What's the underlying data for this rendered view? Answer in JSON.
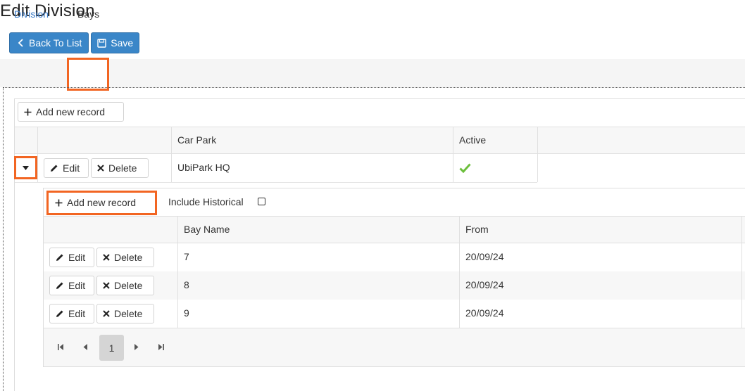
{
  "page": {
    "title": "Edit Division"
  },
  "toolbar": {
    "back_label": "Back To List",
    "save_label": "Save"
  },
  "tabs": [
    {
      "label": "Division"
    },
    {
      "label": "Bays"
    }
  ],
  "outer_grid": {
    "add_label": "Add new record",
    "columns": [
      "Car Park",
      "Active"
    ],
    "rows": [
      {
        "edit_label": "Edit",
        "delete_label": "Delete",
        "car_park": "UbiPark HQ",
        "active": true
      }
    ]
  },
  "inner_grid": {
    "add_label": "Add new record",
    "include_historical_label": "Include Historical",
    "include_historical_checked": false,
    "columns": [
      "Bay Name",
      "From"
    ],
    "rows": [
      {
        "edit_label": "Edit",
        "delete_label": "Delete",
        "bay_name": "7",
        "from": "20/09/24"
      },
      {
        "edit_label": "Edit",
        "delete_label": "Delete",
        "bay_name": "8",
        "from": "20/09/24"
      },
      {
        "edit_label": "Edit",
        "delete_label": "Delete",
        "bay_name": "9",
        "from": "20/09/24"
      }
    ],
    "pager": {
      "current_page": "1"
    }
  },
  "colors": {
    "primary": "#3a86c8",
    "highlight": "#f26522",
    "link": "#3a7bc8",
    "check": "#6cbf3c"
  }
}
